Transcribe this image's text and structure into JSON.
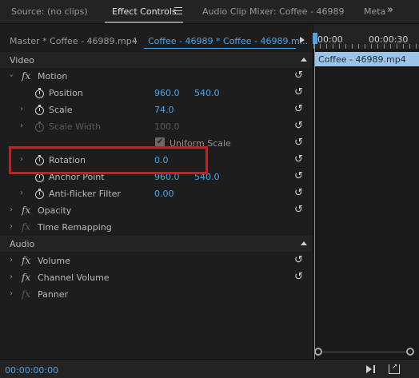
{
  "tabs": [
    {
      "label": "Source: (no clips)"
    },
    {
      "label": "Effect Controls"
    },
    {
      "label": "Audio Clip Mixer: Coffee - 46989"
    },
    {
      "label": "Metad"
    }
  ],
  "overflow_label": "»",
  "source": {
    "master_label": "Master * Coffee - 46989.mp4",
    "sequence_label": "Coffee - 46989 * Coffee - 46989.m..."
  },
  "sections": {
    "video": "Video",
    "audio": "Audio"
  },
  "effects": {
    "motion": "Motion",
    "opacity": "Opacity",
    "time_remapping": "Time Remapping",
    "volume": "Volume",
    "channel_volume": "Channel Volume",
    "panner": "Panner"
  },
  "properties": {
    "position": {
      "label": "Position",
      "x": "960.0",
      "y": "540.0"
    },
    "scale": {
      "label": "Scale",
      "value": "74.0"
    },
    "scale_width": {
      "label": "Scale Width",
      "value": "100.0"
    },
    "uniform_scale": {
      "label": "Uniform Scale",
      "checked": true
    },
    "rotation": {
      "label": "Rotation",
      "value": "0.0"
    },
    "anchor_point": {
      "label": "Anchor Point",
      "x": "960.0",
      "y": "540.0"
    },
    "anti_flicker": {
      "label": "Anti-flicker Filter",
      "value": "0.00"
    }
  },
  "timeline": {
    "start_tc": "00:00",
    "end_tc": "00:00:30",
    "clip_label": "Coffee - 46989.mp4"
  },
  "bottom": {
    "timecode": "00:00:00:00"
  },
  "colors": {
    "accent": "#4fa3e5",
    "highlight": "#e3111b",
    "clip": "#9cc4e8"
  }
}
